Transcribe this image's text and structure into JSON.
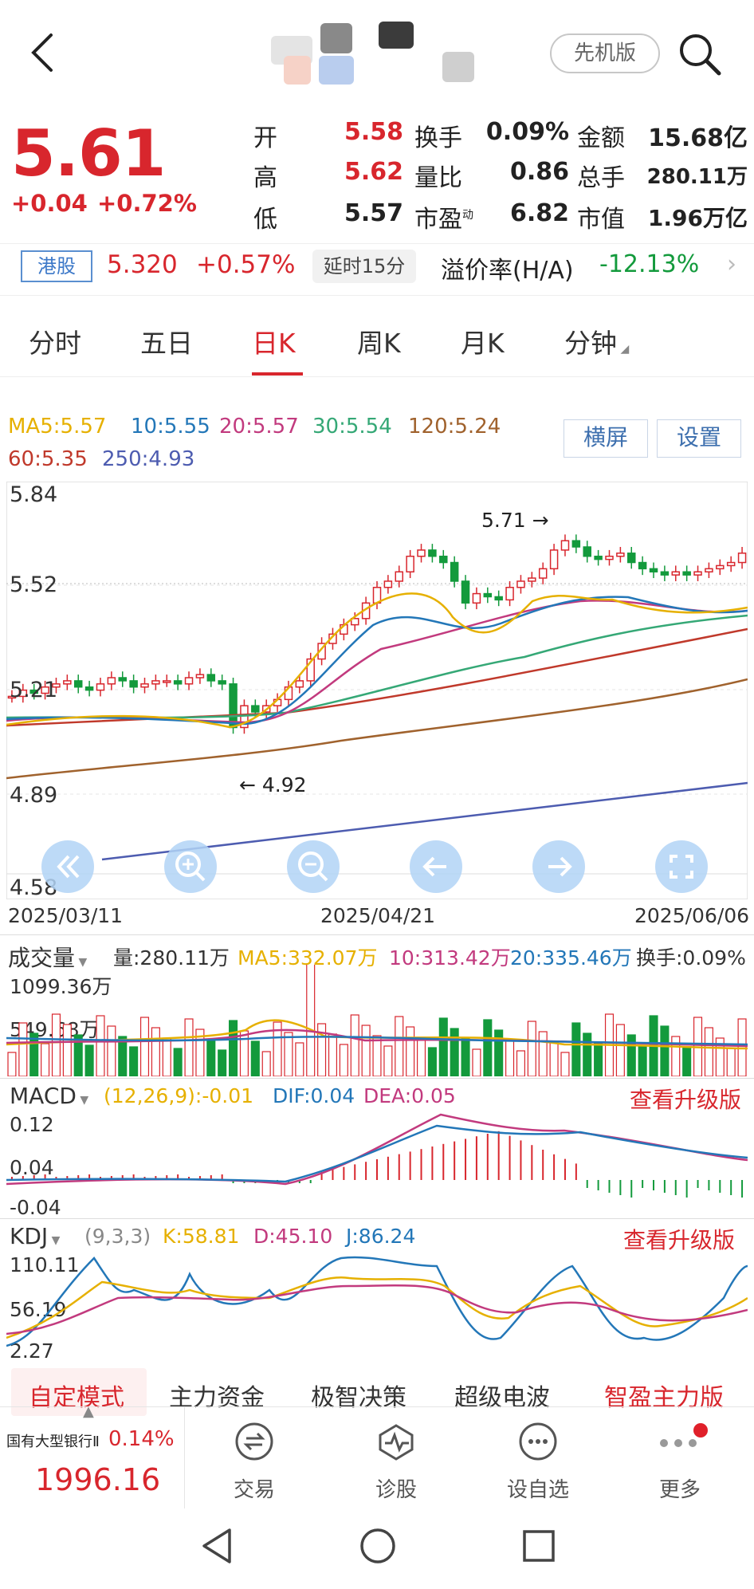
{
  "header": {
    "mode_label": "先机版"
  },
  "quote": {
    "price": "5.61",
    "change": "+0.04",
    "change_pct": "+0.72%",
    "stats": [
      {
        "label": "开",
        "value": "5.58",
        "color": "#d8262d"
      },
      {
        "label": "高",
        "value": "5.62",
        "color": "#d8262d"
      },
      {
        "label": "低",
        "value": "5.57",
        "color": "#222222"
      },
      {
        "label": "换手",
        "value": "0.09%"
      },
      {
        "label": "量比",
        "value": "0.86"
      },
      {
        "label": "市盈",
        "sup": "动",
        "value": "6.82"
      },
      {
        "label": "金额",
        "value": "15.68亿"
      },
      {
        "label": "总手",
        "value": "280.11万"
      },
      {
        "label": "市值",
        "value": "1.96万亿"
      }
    ]
  },
  "hk": {
    "tag": "港股",
    "price": "5.320",
    "change_pct": "+0.57%",
    "delay": "延时15分",
    "premium_label": "溢价率(H/A)",
    "premium_value": "-12.13%"
  },
  "tabs": [
    "分时",
    "五日",
    "日K",
    "周K",
    "月K",
    "分钟"
  ],
  "active_tab": "日K",
  "ma_legend": {
    "ma5": "MA5:5.57",
    "ma10": "10:5.55",
    "ma20": "20:5.57",
    "ma30": "30:5.54",
    "ma120": "120:5.24",
    "ma60": "60:5.35",
    "ma250": "250:4.93"
  },
  "buttons": {
    "landscape": "横屏",
    "settings": "设置"
  },
  "chart": {
    "y_labels": [
      "5.84",
      "5.52",
      "5.21",
      "4.89",
      "4.58"
    ],
    "dates": [
      "2025/03/11",
      "2025/04/21",
      "2025/06/06"
    ],
    "high_annotation": "5.71",
    "low_annotation": "4.92"
  },
  "chart_data": {
    "type": "candlestick",
    "ylim": [
      4.58,
      5.84
    ],
    "dates": [
      "2025/03/11",
      "2025/04/21",
      "2025/06/06"
    ],
    "ma_values": {
      "MA5": 5.57,
      "MA10": 5.55,
      "MA20": 5.57,
      "MA30": 5.54,
      "MA60": 5.35,
      "MA120": 5.24,
      "MA250": 4.93
    },
    "max_price": 5.71,
    "min_price": 4.92
  },
  "volume": {
    "title": "成交量",
    "vol": "量:280.11万",
    "ma5": "MA5:332.07万",
    "ma10": "10:313.42万",
    "ma20": "20:335.46万",
    "turnover": "换手:0.09%",
    "y_top": "1099.36万",
    "y_mid": "549.68万"
  },
  "macd": {
    "title": "MACD",
    "params": "(12,26,9):-0.01",
    "dif": "DIF:0.04",
    "dea": "DEA:0.05",
    "upgrade": "查看升级版",
    "y_labels": [
      "0.12",
      "0.04",
      "-0.04"
    ]
  },
  "kdj": {
    "title": "KDJ",
    "params": "(9,3,3)",
    "k": "K:58.81",
    "d": "D:45.10",
    "j": "J:86.24",
    "upgrade": "查看升级版",
    "y_labels": [
      "110.11",
      "56.19",
      "2.27"
    ]
  },
  "bottom_tabs": [
    "自定模式",
    "主力资金",
    "极智决策",
    "超级电波",
    "智盈主力版"
  ],
  "index": {
    "name": "国有大型银行Ⅱ",
    "pct": "0.14%",
    "value": "1996.16"
  },
  "nav": [
    "交易",
    "诊股",
    "设自选",
    "更多"
  ],
  "colors": {
    "up": "#d8262d",
    "down": "#139a3c",
    "ma5": "#e6b000",
    "ma10": "#2377b8",
    "ma20": "#c23a7e",
    "ma30": "#35a876",
    "ma60": "#c0392b",
    "ma120": "#a0622d",
    "ma250": "#4d5cb0"
  }
}
